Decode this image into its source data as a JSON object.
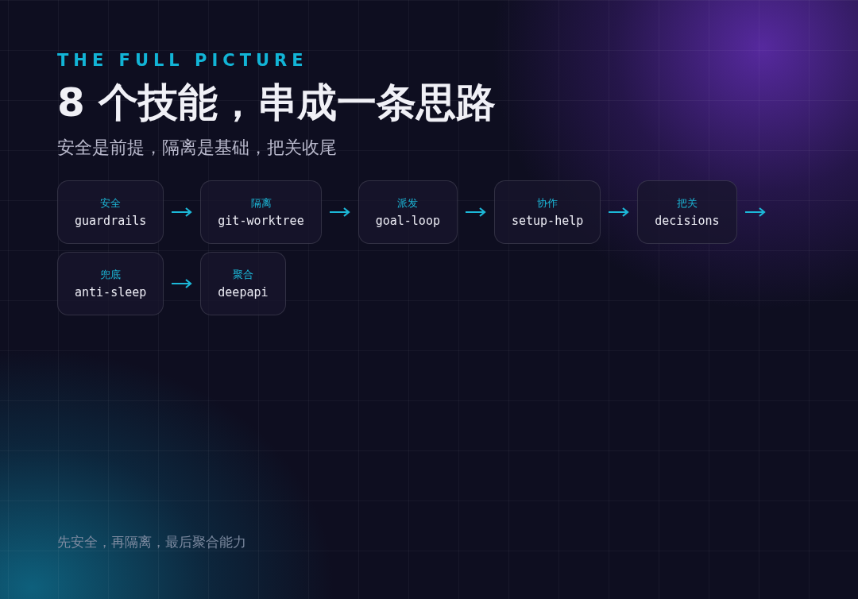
{
  "eyebrow": "THE FULL PICTURE",
  "title": "8 个技能，串成一条思路",
  "subtitle": "安全是前提，隔离是基础，把关收尾",
  "steps": [
    {
      "label": "安全",
      "name": "guardrails"
    },
    {
      "label": "隔离",
      "name": "git-worktree"
    },
    {
      "label": "派发",
      "name": "goal-loop"
    },
    {
      "label": "协作",
      "name": "setup-help"
    },
    {
      "label": "把关",
      "name": "decisions"
    },
    {
      "label": "兜底",
      "name": "anti-sleep"
    },
    {
      "label": "聚合",
      "name": "deepapi"
    }
  ],
  "footer": "先安全，再隔离，最后聚合能力"
}
